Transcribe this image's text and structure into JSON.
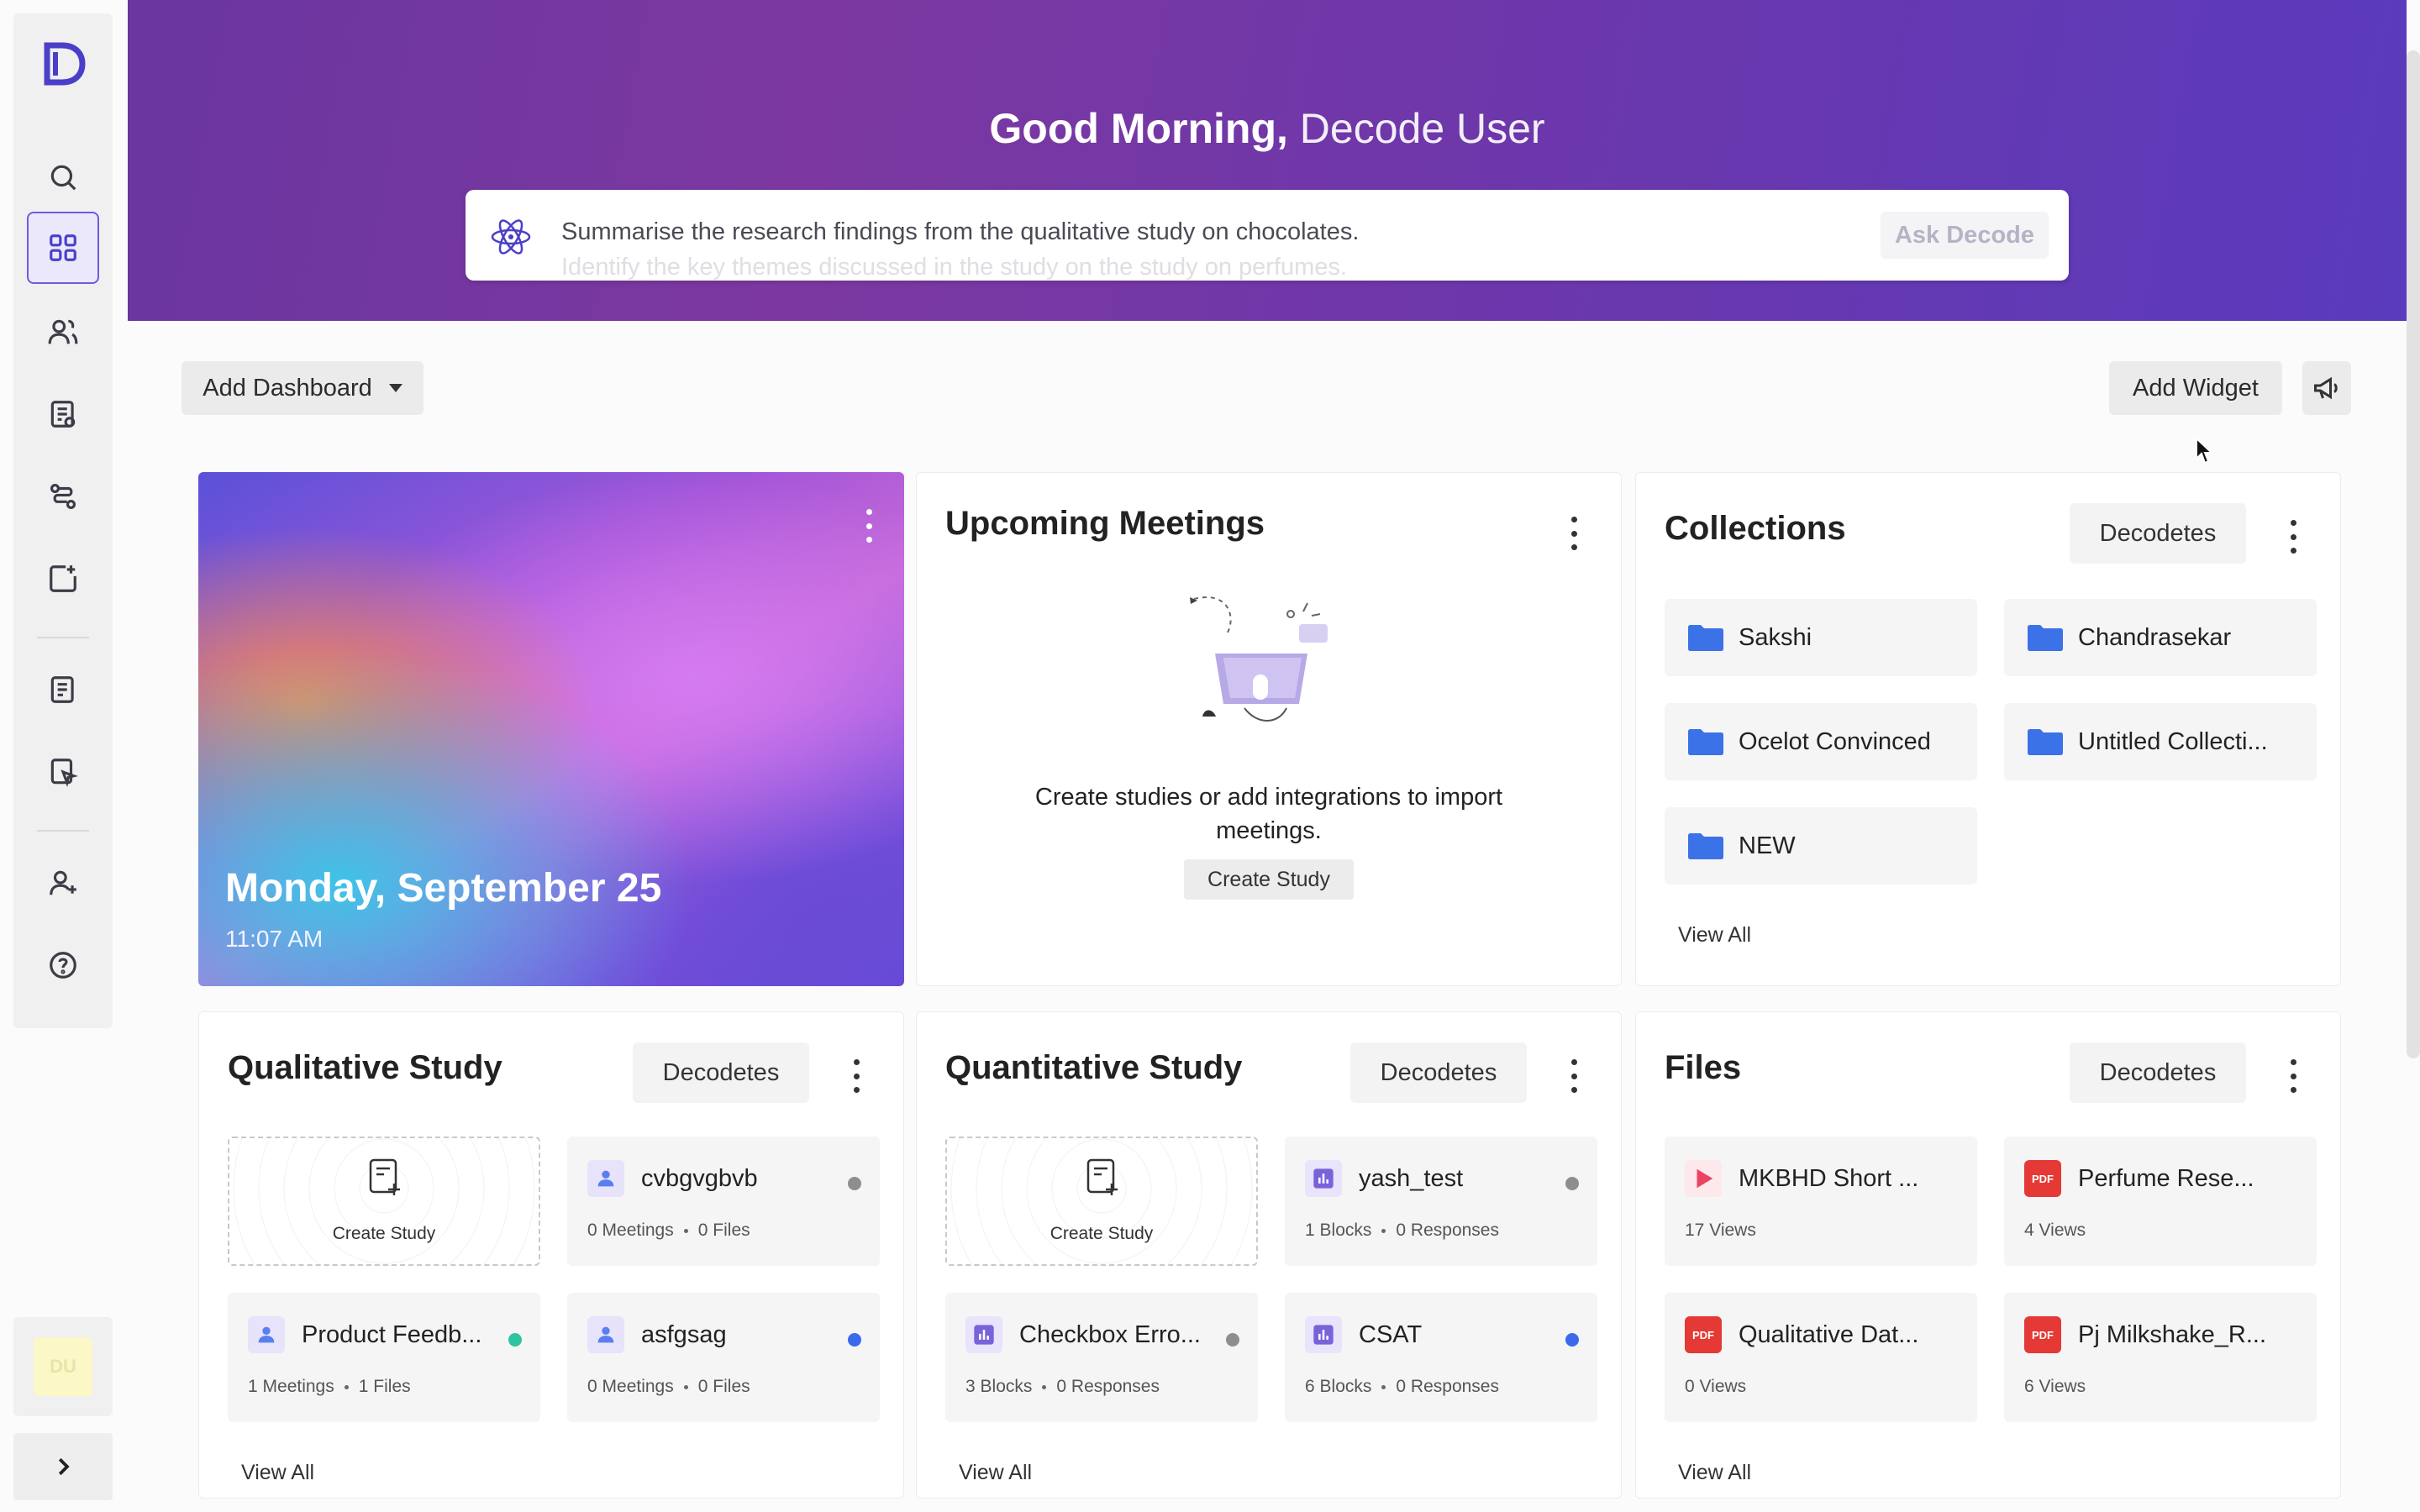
{
  "sidebar": {
    "logo": "D",
    "items": [
      {
        "name": "search-icon"
      },
      {
        "name": "dashboard-icon"
      },
      {
        "name": "users-icon"
      },
      {
        "name": "study-list-icon"
      },
      {
        "name": "workflow-icon"
      },
      {
        "name": "add-project-icon"
      },
      {
        "name": "notes-icon"
      },
      {
        "name": "pointer-doc-icon"
      },
      {
        "name": "add-user-icon"
      },
      {
        "name": "help-icon"
      }
    ],
    "avatar": "DU"
  },
  "header": {
    "greeting": "Good Morning,",
    "user_name": "Decode User",
    "ask_prompt": "Summarise the research findings from the qualitative study on chocolates.",
    "ask_prompt_next": "Identify the key themes discussed in the study on the study on perfumes.",
    "ask_button": "Ask Decode"
  },
  "toolbar": {
    "add_dashboard": "Add Dashboard",
    "add_widget": "Add Widget"
  },
  "hero": {
    "date": "Monday, September 25",
    "time": "11:07 AM"
  },
  "meetings": {
    "title": "Upcoming Meetings",
    "empty_text": "Create studies or add integrations to import meetings.",
    "create_button": "Create Study"
  },
  "collections": {
    "title": "Collections",
    "tag": "Decodetes",
    "items": [
      "Sakshi",
      "Chandrasekar",
      "Ocelot Convinced",
      "Untitled Collecti...",
      "NEW"
    ],
    "view_all": "View All"
  },
  "qualitative": {
    "title": "Qualitative Study",
    "tag": "Decodetes",
    "create_label": "Create Study",
    "items": [
      {
        "name": "cvbgvgbvb",
        "count1": "0",
        "unit1": "Meetings",
        "count2": "0",
        "unit2": "Files",
        "status": "#8e8e8e"
      },
      {
        "name": "Product Feedb...",
        "count1": "1",
        "unit1": "Meetings",
        "count2": "1",
        "unit2": "Files",
        "status": "#2ec4a0"
      },
      {
        "name": "asfgsag",
        "count1": "0",
        "unit1": "Meetings",
        "count2": "0",
        "unit2": "Files",
        "status": "#3b6bea"
      }
    ],
    "view_all": "View All"
  },
  "quantitative": {
    "title": "Quantitative Study",
    "tag": "Decodetes",
    "create_label": "Create Study",
    "items": [
      {
        "name": "yash_test",
        "count1": "1",
        "unit1": "Blocks",
        "count2": "0",
        "unit2": "Responses",
        "status": "#8e8e8e"
      },
      {
        "name": "Checkbox Erro...",
        "count1": "3",
        "unit1": "Blocks",
        "count2": "0",
        "unit2": "Responses",
        "status": "#8e8e8e"
      },
      {
        "name": "CSAT",
        "count1": "6",
        "unit1": "Blocks",
        "count2": "0",
        "unit2": "Responses",
        "status": "#3b6bea"
      }
    ],
    "view_all": "View All"
  },
  "files": {
    "title": "Files",
    "tag": "Decodetes",
    "items": [
      {
        "name": "MKBHD Short ...",
        "views": "17",
        "unit": "Views",
        "type": "video-icon"
      },
      {
        "name": "Perfume Rese...",
        "views": "4",
        "unit": "Views",
        "type": "pdf-icon"
      },
      {
        "name": "Qualitative Dat...",
        "views": "0",
        "unit": "Views",
        "type": "pdf-icon"
      },
      {
        "name": "Pj Milkshake_R...",
        "views": "6",
        "unit": "Views",
        "type": "pdf-icon"
      }
    ],
    "pdf_label": "PDF",
    "view_all": "View All"
  },
  "colors": {
    "accent": "#4b3fc9",
    "header_start": "#6a36a0",
    "header_end": "#5a3bbd",
    "folder": "#3b72e8"
  }
}
